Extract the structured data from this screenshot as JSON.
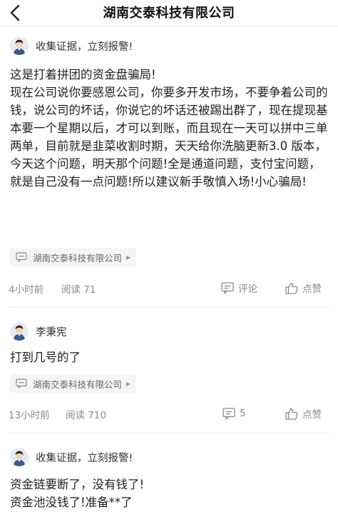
{
  "header": {
    "title": "湖南交泰科技有限公司",
    "back_icon": "chevron-left-icon"
  },
  "posts": [
    {
      "username": "收集证据，立刻报警!",
      "content": [
        "这是打着拼团的资金盘骗局!",
        "现在公司说你要感恩公司，你要多开发市场，不要争着公司的钱，说公司的坏话，你说它的坏话还被踢出群了，现在提现基本要一个星期以后，才可以到账，而且现在一天可以拼中三单两单，目前就是韭菜收割时期，天天给你洗脑更新3.0 版本，今天这个问题，明天那个问题!全是通道问题，支付宝问题，就是自己没有一点问题!所以建议新手敬慎入场!小心骗局!"
      ],
      "tag": "湖南交泰科技有限公司",
      "time": "4小时前",
      "reads": "阅读 71",
      "comment_label": "评论",
      "like_label": "点赞"
    },
    {
      "username": "李秉宪",
      "content": [
        "打到几号的了"
      ],
      "tag": "湖南交泰科技有限公司",
      "time": "13小时前",
      "reads": "阅读 710",
      "comment_label": "5",
      "like_label": "点赞"
    },
    {
      "username": "收集证据，立刻报警!",
      "content": [
        "资金链要断了，没有钱了!",
        "资金池没钱了!准备**了"
      ]
    }
  ],
  "colors": {
    "text": "#1f1f1f",
    "meta": "#8a8a8a",
    "divider": "#ececec",
    "tag_bg": "#f5f5f5"
  }
}
